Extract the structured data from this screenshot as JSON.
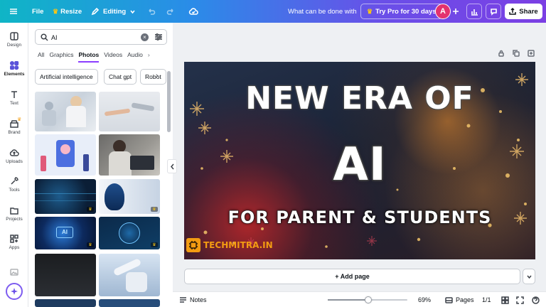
{
  "topbar": {
    "file_label": "File",
    "resize_label": "Resize",
    "editing_label": "Editing",
    "prompt_text": "What can be done with",
    "try_pro_label": "Try Pro for 30 days",
    "avatar_initial": "A",
    "share_label": "Share",
    "icons": [
      "menu-icon",
      "crown-icon",
      "pencil-icon",
      "chevron-down-icon",
      "undo-icon",
      "redo-icon",
      "cloud-save-icon",
      "plus-icon",
      "chart-icon",
      "comment-icon",
      "share-icon"
    ]
  },
  "rail": {
    "items": [
      {
        "label": "Design",
        "icon": "design-icon",
        "active": false
      },
      {
        "label": "Elements",
        "icon": "elements-icon",
        "active": true
      },
      {
        "label": "Text",
        "icon": "text-icon",
        "active": false
      },
      {
        "label": "Brand",
        "icon": "brand-icon",
        "active": false
      },
      {
        "label": "Uploads",
        "icon": "uploads-icon",
        "active": false
      },
      {
        "label": "Tools",
        "icon": "tools-icon",
        "active": false
      },
      {
        "label": "Projects",
        "icon": "projects-icon",
        "active": false
      },
      {
        "label": "Apps",
        "icon": "apps-icon",
        "active": false
      }
    ]
  },
  "panel": {
    "search_value": "AI",
    "tabs": [
      {
        "label": "All",
        "active": false
      },
      {
        "label": "Graphics",
        "active": false
      },
      {
        "label": "Photos",
        "active": true
      },
      {
        "label": "Videos",
        "active": false
      },
      {
        "label": "Audio",
        "active": false
      }
    ],
    "chips": [
      "Artificial intelligence",
      "Chat gpt",
      "Robot"
    ],
    "thumbnails": [
      {
        "desc": "robot-office-photo",
        "premium": false
      },
      {
        "desc": "robot-hand-photo",
        "premium": false
      },
      {
        "desc": "ai-illustration",
        "premium": false
      },
      {
        "desc": "laptop-work-photo",
        "premium": false
      },
      {
        "desc": "dark-network-photo",
        "premium": true
      },
      {
        "desc": "ai-face-photo",
        "premium": true
      },
      {
        "desc": "ai-chip-photo",
        "premium": true
      },
      {
        "desc": "digital-globe-photo",
        "premium": true
      },
      {
        "desc": "dark-texture-photo",
        "premium": false
      },
      {
        "desc": "robot-arm-photo",
        "premium": false
      }
    ]
  },
  "design": {
    "headline": "NEW  ERA OF",
    "big_text": "AI",
    "subline": "FOR PARENT & STUDENTS",
    "brand_text": "TECHMITRA.IN"
  },
  "canvas": {
    "add_page_label": "+ Add page"
  },
  "bottombar": {
    "notes_label": "Notes",
    "zoom": "69%",
    "zoom_fraction": 0.69,
    "pages_label": "Pages",
    "page_count": "1/1"
  },
  "colors": {
    "accent": "#8b3dff",
    "avatar": "#e3326f",
    "brand_orange": "#f39c12"
  }
}
